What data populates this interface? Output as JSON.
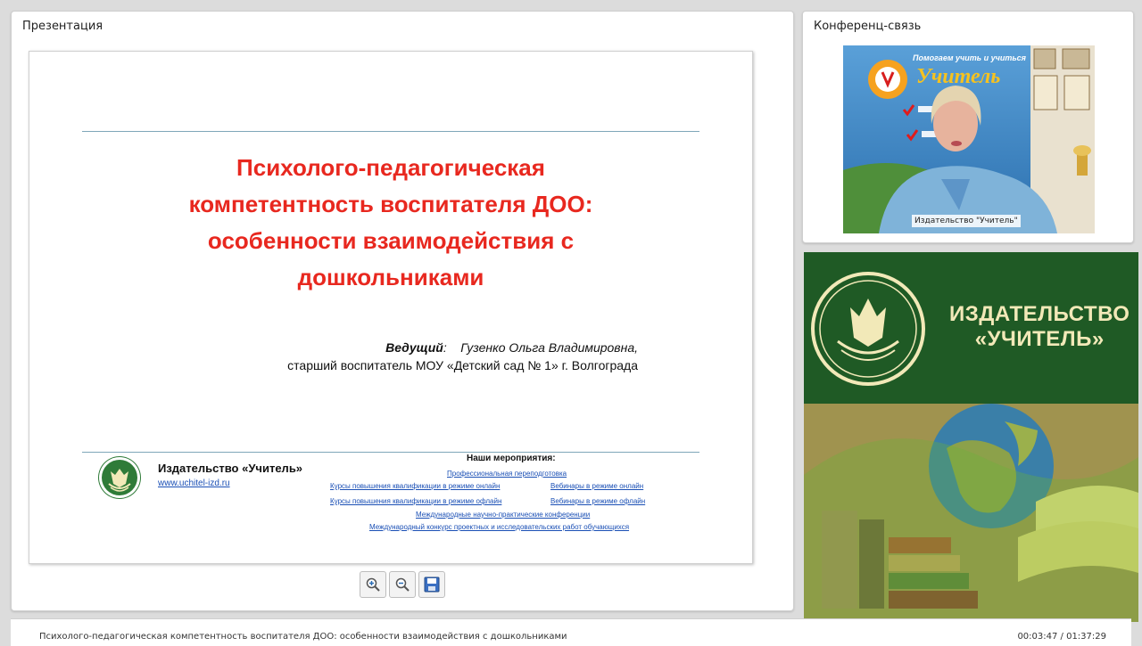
{
  "presentation_panel": {
    "title": "Презентация",
    "slide": {
      "title_lines": [
        "Психолого-педагогическая",
        "компетентность воспитателя ДОО:",
        "особенности взаимодействия с",
        "дошкольниками"
      ],
      "presenter_label": "Ведущий",
      "presenter_name": "Гузенко Ольга Владимировна,",
      "presenter_position": "старший воспитатель МОУ «Детский сад № 1» г. Волгограда",
      "publisher_name": "Издательство «Учитель»",
      "publisher_url": "www.uchitel-izd.ru",
      "events_heading": "Наши мероприятия:",
      "events": [
        "Профессиональная переподготовка",
        "Курсы повышения квалификации в режиме онлайн",
        "Вебинары в режиме онлайн",
        "Курсы повышения квалификации в режиме офлайн",
        "Вебинары в режиме офлайн",
        "Международные научно-практические конференции",
        "Международный конкурс проектных и исследовательских работ обучающихся"
      ]
    },
    "toolbar": {
      "zoom_in_icon": "zoom-in-icon",
      "zoom_out_icon": "zoom-out-icon",
      "save_icon": "save-icon"
    }
  },
  "conference_panel": {
    "title": "Конференц-связь",
    "video_caption": "Издательство \"Учитель\"",
    "background_slogan": "Помогаем учить и учиться",
    "background_brand": "Учитель"
  },
  "ad_panel": {
    "title_line1": "ИЗДАТЕЛЬСТВО",
    "title_line2": "«УЧИТЕЛЬ»"
  },
  "status_bar": {
    "title": "Психолого-педагогическая компетентность воспитателя ДОО: особенности взаимодействия с дошкольниками",
    "time": "00:03:47 / 01:37:29"
  },
  "colors": {
    "slide_title": "#e8281f",
    "link": "#1a4fb5",
    "brand_green": "#1f5a25",
    "brand_cream": "#f2e9b8"
  }
}
